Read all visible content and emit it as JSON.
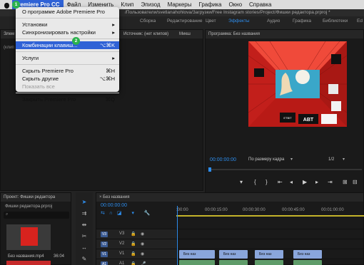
{
  "menubar": {
    "app": "Premiere Pro CC",
    "items": [
      "Файл",
      "Изменить",
      "Клип",
      "Эпизод",
      "Маркеры",
      "Графика",
      "Окно",
      "Справка"
    ]
  },
  "window_title": "/Пользователи/svetlanahohlova/Загрузки/Free Instagram stories/Project/Фишки редактора.prproj *",
  "workspaces": [
    "Сборка",
    "Редактирование",
    "Цвет",
    "Эффекты",
    "Аудио",
    "Графика",
    "Библиотеки",
    "Ed"
  ],
  "active_workspace": "Эффекты",
  "app_menu": {
    "items": [
      {
        "label": "О программе Adobe Premiere Pro",
        "shortcut": "",
        "state": "normal"
      },
      {
        "label": "Установки",
        "shortcut": "▸",
        "state": "normal"
      },
      {
        "label": "Синхронизировать настройки",
        "shortcut": "▸",
        "state": "normal"
      },
      {
        "label": "Комбинации клавиш...",
        "shortcut": "⌥⌘K",
        "state": "highlighted"
      },
      {
        "label": "Услуги",
        "shortcut": "▸",
        "state": "normal"
      },
      {
        "label": "Скрыть Premiere Pro",
        "shortcut": "⌘H",
        "state": "normal"
      },
      {
        "label": "Скрыть другие",
        "shortcut": "⌥⌘H",
        "state": "normal"
      },
      {
        "label": "Показать все",
        "shortcut": "",
        "state": "disabled"
      },
      {
        "label": "Закрыть Premiere Pro",
        "shortcut": "⌘Q",
        "state": "normal"
      }
    ]
  },
  "badges": {
    "one": "1",
    "two": "2"
  },
  "source_panel": {
    "tab1": "Элем",
    "source_tab": "Источник: (нет клипов)",
    "tab3": "Микш",
    "clip_label": "(клип"
  },
  "program": {
    "title": "Программа: Без названия",
    "timecode": "00:00:00:00",
    "fit": "По размеру кадра",
    "ratio": "1/2",
    "art_text_1": "ABT",
    "art_text_2": "ETBIT"
  },
  "project": {
    "title": "Проект: Фишки редактора",
    "file": "Фишки редактора.prproj",
    "clip_name": "Без названия.mp4",
    "clip_duration": "36:04"
  },
  "timeline": {
    "title": "Без названия",
    "timecode": "00:00:00:00",
    "ruler": [
      ":00:00",
      "00:00:15:00",
      "00:00:30:00",
      "00:00:45:00",
      "00:01:00:00"
    ],
    "tracks": [
      {
        "id": "V3",
        "name": "V3"
      },
      {
        "id": "V2",
        "name": "V2"
      },
      {
        "id": "V1",
        "name": "V1"
      },
      {
        "id": "A1",
        "name": "A1"
      }
    ],
    "clip_label": "Без наз"
  },
  "colors": {
    "accent": "#2d8ceb",
    "highlight": "#2f62d6",
    "video_clip": "#8aa6dc",
    "audio_clip": "#5f9c69"
  }
}
